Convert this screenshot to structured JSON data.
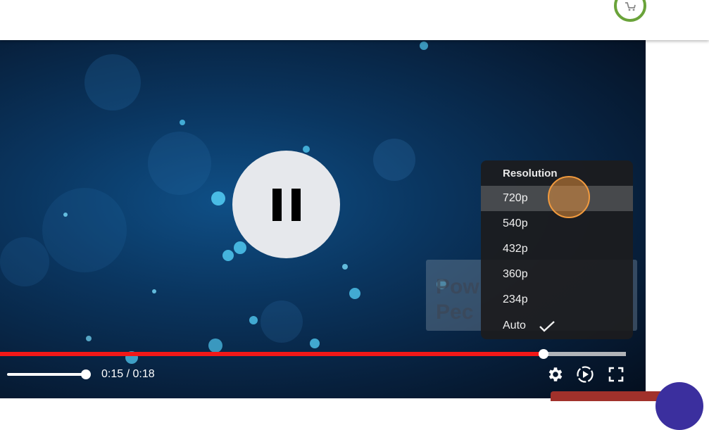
{
  "video": {
    "current_time": "0:15",
    "duration": "0:18",
    "time_display": "0:15 / 0:18",
    "progress_fraction": 0.868,
    "volume_fraction": 1.0
  },
  "overlay": {
    "line1": "Pow",
    "line2": "Pec"
  },
  "resolution_menu": {
    "title": "Resolution",
    "options": [
      {
        "label": "720p",
        "highlighted": true,
        "selected": false
      },
      {
        "label": "540p",
        "highlighted": false,
        "selected": false
      },
      {
        "label": "432p",
        "highlighted": false,
        "selected": false
      },
      {
        "label": "360p",
        "highlighted": false,
        "selected": false
      },
      {
        "label": "234p",
        "highlighted": false,
        "selected": false
      },
      {
        "label": "Auto",
        "highlighted": false,
        "selected": true
      }
    ]
  },
  "icons": {
    "cart": "shopping-cart-icon",
    "pause": "pause-icon",
    "settings": "gear-icon",
    "autoplay": "autoplay-icon",
    "fullscreen": "fullscreen-icon",
    "check": "checkmark-icon"
  },
  "colors": {
    "progress_played": "#f21818",
    "cart_ring": "#6aa33a",
    "fab": "#3b2f9e",
    "side_button": "#a1312b",
    "cursor": "#f19a3e"
  }
}
